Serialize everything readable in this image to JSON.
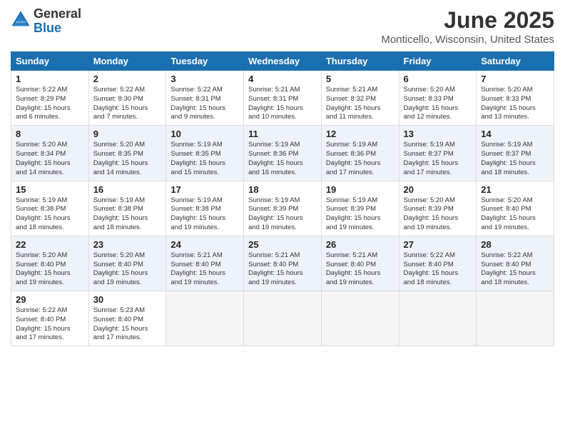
{
  "logo": {
    "general": "General",
    "blue": "Blue"
  },
  "title": "June 2025",
  "location": "Monticello, Wisconsin, United States",
  "days_header": [
    "Sunday",
    "Monday",
    "Tuesday",
    "Wednesday",
    "Thursday",
    "Friday",
    "Saturday"
  ],
  "weeks": [
    [
      {
        "day": "1",
        "sunrise": "5:22 AM",
        "sunset": "8:29 PM",
        "daylight": "15 hours and 6 minutes."
      },
      {
        "day": "2",
        "sunrise": "5:22 AM",
        "sunset": "8:30 PM",
        "daylight": "15 hours and 7 minutes."
      },
      {
        "day": "3",
        "sunrise": "5:22 AM",
        "sunset": "8:31 PM",
        "daylight": "15 hours and 9 minutes."
      },
      {
        "day": "4",
        "sunrise": "5:21 AM",
        "sunset": "8:31 PM",
        "daylight": "15 hours and 10 minutes."
      },
      {
        "day": "5",
        "sunrise": "5:21 AM",
        "sunset": "8:32 PM",
        "daylight": "15 hours and 11 minutes."
      },
      {
        "day": "6",
        "sunrise": "5:20 AM",
        "sunset": "8:33 PM",
        "daylight": "15 hours and 12 minutes."
      },
      {
        "day": "7",
        "sunrise": "5:20 AM",
        "sunset": "8:33 PM",
        "daylight": "15 hours and 13 minutes."
      }
    ],
    [
      {
        "day": "8",
        "sunrise": "5:20 AM",
        "sunset": "8:34 PM",
        "daylight": "15 hours and 14 minutes."
      },
      {
        "day": "9",
        "sunrise": "5:20 AM",
        "sunset": "8:35 PM",
        "daylight": "15 hours and 14 minutes."
      },
      {
        "day": "10",
        "sunrise": "5:19 AM",
        "sunset": "8:35 PM",
        "daylight": "15 hours and 15 minutes."
      },
      {
        "day": "11",
        "sunrise": "5:19 AM",
        "sunset": "8:36 PM",
        "daylight": "15 hours and 16 minutes."
      },
      {
        "day": "12",
        "sunrise": "5:19 AM",
        "sunset": "8:36 PM",
        "daylight": "15 hours and 17 minutes."
      },
      {
        "day": "13",
        "sunrise": "5:19 AM",
        "sunset": "8:37 PM",
        "daylight": "15 hours and 17 minutes."
      },
      {
        "day": "14",
        "sunrise": "5:19 AM",
        "sunset": "8:37 PM",
        "daylight": "15 hours and 18 minutes."
      }
    ],
    [
      {
        "day": "15",
        "sunrise": "5:19 AM",
        "sunset": "8:38 PM",
        "daylight": "15 hours and 18 minutes."
      },
      {
        "day": "16",
        "sunrise": "5:19 AM",
        "sunset": "8:38 PM",
        "daylight": "15 hours and 18 minutes."
      },
      {
        "day": "17",
        "sunrise": "5:19 AM",
        "sunset": "8:38 PM",
        "daylight": "15 hours and 19 minutes."
      },
      {
        "day": "18",
        "sunrise": "5:19 AM",
        "sunset": "8:39 PM",
        "daylight": "15 hours and 19 minutes."
      },
      {
        "day": "19",
        "sunrise": "5:19 AM",
        "sunset": "8:39 PM",
        "daylight": "15 hours and 19 minutes."
      },
      {
        "day": "20",
        "sunrise": "5:20 AM",
        "sunset": "8:39 PM",
        "daylight": "15 hours and 19 minutes."
      },
      {
        "day": "21",
        "sunrise": "5:20 AM",
        "sunset": "8:40 PM",
        "daylight": "15 hours and 19 minutes."
      }
    ],
    [
      {
        "day": "22",
        "sunrise": "5:20 AM",
        "sunset": "8:40 PM",
        "daylight": "15 hours and 19 minutes."
      },
      {
        "day": "23",
        "sunrise": "5:20 AM",
        "sunset": "8:40 PM",
        "daylight": "15 hours and 19 minutes."
      },
      {
        "day": "24",
        "sunrise": "5:21 AM",
        "sunset": "8:40 PM",
        "daylight": "15 hours and 19 minutes."
      },
      {
        "day": "25",
        "sunrise": "5:21 AM",
        "sunset": "8:40 PM",
        "daylight": "15 hours and 19 minutes."
      },
      {
        "day": "26",
        "sunrise": "5:21 AM",
        "sunset": "8:40 PM",
        "daylight": "15 hours and 19 minutes."
      },
      {
        "day": "27",
        "sunrise": "5:22 AM",
        "sunset": "8:40 PM",
        "daylight": "15 hours and 18 minutes."
      },
      {
        "day": "28",
        "sunrise": "5:22 AM",
        "sunset": "8:40 PM",
        "daylight": "15 hours and 18 minutes."
      }
    ],
    [
      {
        "day": "29",
        "sunrise": "5:22 AM",
        "sunset": "8:40 PM",
        "daylight": "15 hours and 17 minutes."
      },
      {
        "day": "30",
        "sunrise": "5:23 AM",
        "sunset": "8:40 PM",
        "daylight": "15 hours and 17 minutes."
      },
      null,
      null,
      null,
      null,
      null
    ]
  ],
  "labels": {
    "sunrise": "Sunrise:",
    "sunset": "Sunset:",
    "daylight": "Daylight:"
  }
}
